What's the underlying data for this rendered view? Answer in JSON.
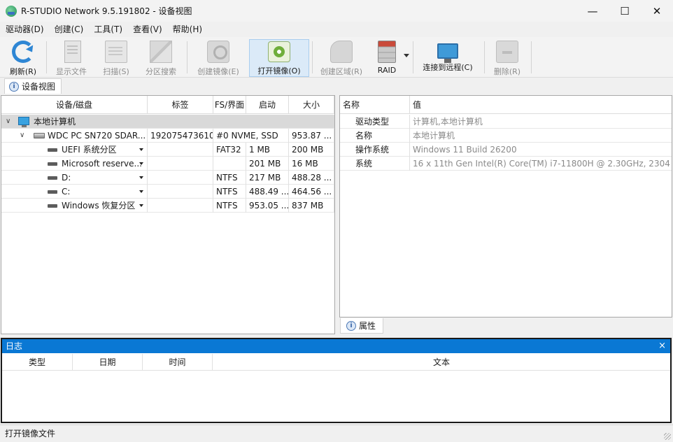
{
  "window": {
    "title": "R-STUDIO Network 9.5.191802 - 设备视图",
    "controls": {
      "minimize": "—",
      "maximize": "☐",
      "close": "✕"
    }
  },
  "menu": [
    "驱动器(D)",
    "创建(C)",
    "工具(T)",
    "查看(V)",
    "帮助(H)"
  ],
  "toolbar": {
    "refresh": "刷新(R)",
    "show_files": "显示文件",
    "scan": "扫描(S)",
    "partition_search": "分区搜索",
    "create_image": "创建镜像(E)",
    "open_image": "打开镜像(O)",
    "create_region": "创建区域(R)",
    "raid": "RAID",
    "connect_remote": "连接到远程(C)",
    "delete": "删除(R)"
  },
  "view_tab": {
    "label": "设备视图",
    "icon": "info-icon"
  },
  "device_table": {
    "columns": [
      "设备/磁盘",
      "标签",
      "FS/界面",
      "启动",
      "大小"
    ],
    "group": "本地计算机",
    "rows": [
      {
        "name": "WDC PC SN720 SDAR...",
        "label": "192075473610",
        "fs": "#0 NVME, SSD",
        "start": "",
        "size": "953.87 ..."
      },
      {
        "name": "UEFI 系统分区",
        "label": "",
        "fs": "FAT32",
        "start": "1 MB",
        "size": "200 MB"
      },
      {
        "name": "Microsoft reserve...",
        "label": "",
        "fs": "",
        "start": "201 MB",
        "size": "16 MB"
      },
      {
        "name": "D:",
        "label": "",
        "fs": "NTFS",
        "start": "217 MB",
        "size": "488.28 ..."
      },
      {
        "name": "C:",
        "label": "",
        "fs": "NTFS",
        "start": "488.49 ...",
        "size": "464.56 ..."
      },
      {
        "name": "Windows 恢复分区",
        "label": "",
        "fs": "NTFS",
        "start": "953.05 ...",
        "size": "837 MB"
      }
    ]
  },
  "properties": {
    "columns": [
      "名称",
      "值"
    ],
    "rows": [
      {
        "key": "驱动类型",
        "value": "计算机,本地计算机"
      },
      {
        "key": "名称",
        "value": "本地计算机"
      },
      {
        "key": "操作系统",
        "value": "Windows 11 Build 26200"
      },
      {
        "key": "系统",
        "value": "16 x 11th Gen Intel(R) Core(TM) i7-11800H @ 2.30GHz, 2304 ..."
      }
    ],
    "tab": "属性"
  },
  "log": {
    "title": "日志",
    "close": "×",
    "columns": [
      "类型",
      "日期",
      "时间",
      "文本"
    ]
  },
  "status": "打开镜像文件",
  "colors": {
    "accent": "#0a78d4",
    "toolbar_active": "#dbeaf8",
    "group_row": "#d9d9d9"
  }
}
